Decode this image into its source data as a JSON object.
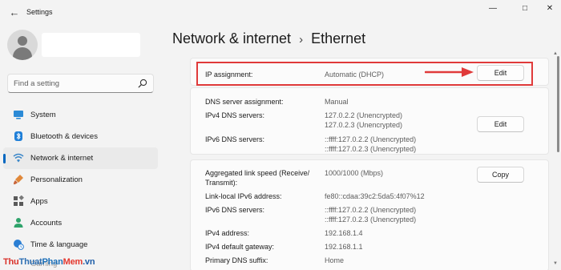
{
  "window": {
    "title": "Settings",
    "back_glyph": "←",
    "minimize_glyph": "—",
    "maximize_glyph": "□",
    "close_glyph": "✕"
  },
  "sidebar": {
    "search_placeholder": "Find a setting",
    "items": [
      {
        "label": "System",
        "icon": "monitor-icon",
        "selected": false
      },
      {
        "label": "Bluetooth & devices",
        "icon": "bluetooth-icon",
        "selected": false
      },
      {
        "label": "Network & internet",
        "icon": "wifi-icon",
        "selected": true
      },
      {
        "label": "Personalization",
        "icon": "brush-icon",
        "selected": false
      },
      {
        "label": "Apps",
        "icon": "apps-icon",
        "selected": false
      },
      {
        "label": "Accounts",
        "icon": "person-icon",
        "selected": false
      },
      {
        "label": "Time & language",
        "icon": "globe-clock-icon",
        "selected": false
      },
      {
        "label": "Gaming",
        "icon": "controller-icon",
        "selected": false
      }
    ]
  },
  "breadcrumb": {
    "parent": "Network & internet",
    "separator": "›",
    "current": "Ethernet"
  },
  "ip_card": {
    "label": "IP assignment:",
    "value": "Automatic (DHCP)",
    "button": "Edit"
  },
  "dns_card": {
    "assignment_label": "DNS server assignment:",
    "assignment_value": "Manual",
    "ipv4_label": "IPv4 DNS servers:",
    "ipv4_values": [
      "127.0.2.2 (Unencrypted)",
      "127.0.2.3 (Unencrypted)"
    ],
    "ipv6_label": "IPv6 DNS servers:",
    "ipv6_values": [
      "::ffff:127.0.2.2 (Unencrypted)",
      "::ffff:127.0.2.3 (Unencrypted)"
    ],
    "button": "Edit"
  },
  "props_card": {
    "button": "Copy",
    "rows": [
      {
        "label": "Aggregated link speed (Receive/",
        "label2": "Transmit):",
        "value": "1000/1000 (Mbps)"
      },
      {
        "label": "Link-local IPv6 address:",
        "value": "fe80::cdaa:39c2:5da5:4f07%12"
      },
      {
        "label": "IPv6 DNS servers:",
        "values": [
          "::ffff:127.0.2.2 (Unencrypted)",
          "::ffff:127.0.2.3 (Unencrypted)"
        ]
      },
      {
        "label": "IPv4 address:",
        "value": "192.168.1.4"
      },
      {
        "label": "IPv4 default gateway:",
        "value": "192.168.1.1"
      },
      {
        "label": "Primary DNS suffix:",
        "value": "Home"
      }
    ]
  },
  "watermark": {
    "part1": "Thu",
    "part2": "Thuat",
    "part3": "Phan",
    "part4": "Mem",
    "part5": ".vn"
  },
  "colors": {
    "accent": "#0067c0",
    "highlight_border": "#e03a3a",
    "arrow": "#e03a3a"
  }
}
